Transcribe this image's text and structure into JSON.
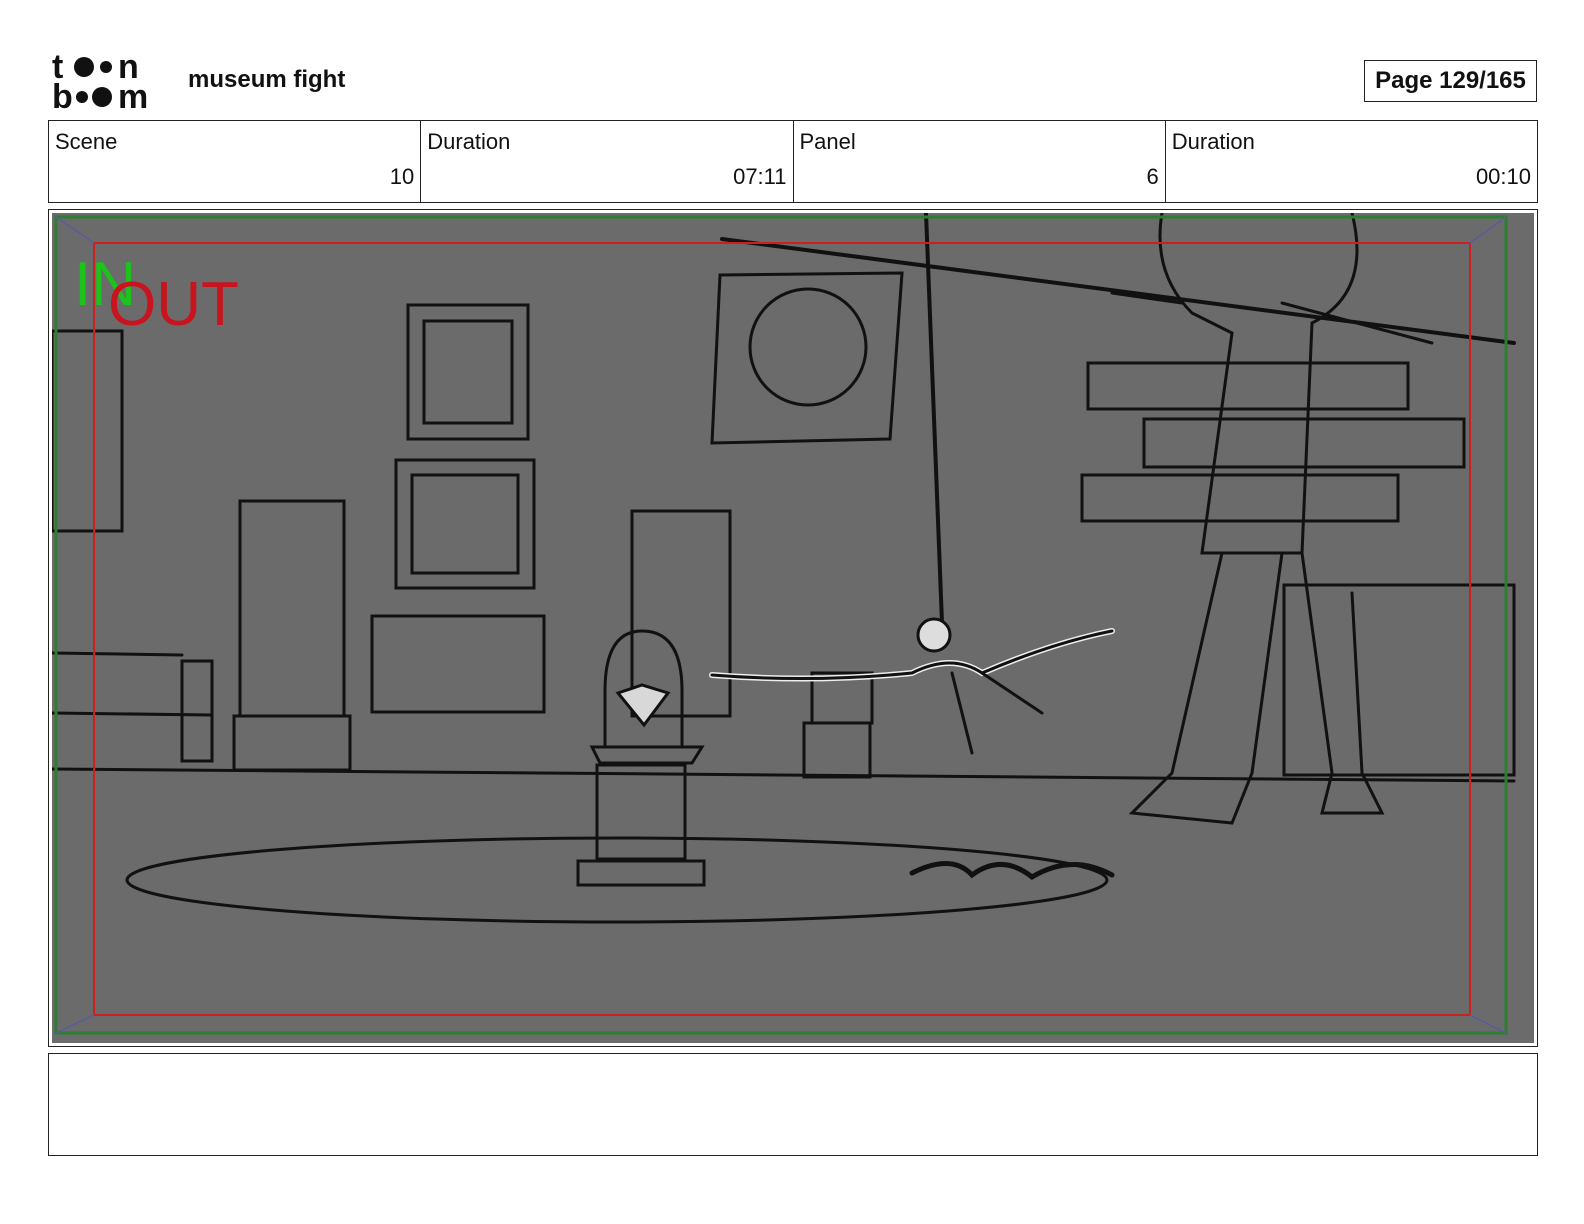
{
  "header": {
    "logo_text": "toon boom",
    "project_title": "museum fight",
    "page_label": "Page 129/165"
  },
  "info": {
    "scene_label": "Scene",
    "scene_value": "10",
    "scene_duration_label": "Duration",
    "scene_duration_value": "07:11",
    "panel_label": "Panel",
    "panel_value": "6",
    "panel_duration_label": "Duration",
    "panel_duration_value": "00:10"
  },
  "panel": {
    "in_marker": "IN",
    "out_marker": "OUT",
    "colors": {
      "background": "#6b6b6b",
      "safe_frame": "#2e7d32",
      "title_safe": "#cc1f1f",
      "in_color": "#1dc21d",
      "out_color": "#c8141e"
    }
  },
  "notes": {
    "text": ""
  }
}
